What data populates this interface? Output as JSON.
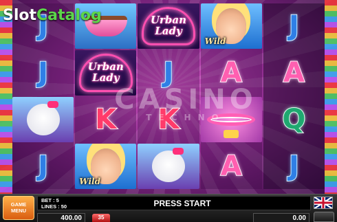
{
  "brand": {
    "slot": "Slot",
    "catalog": "Catalog"
  },
  "watermark": {
    "line1": "CASINO",
    "line2": "TECHNO"
  },
  "reels": [
    [
      {
        "type": "j",
        "glyph": "J"
      },
      {
        "type": "j",
        "glyph": "J"
      },
      {
        "type": "dog"
      },
      {
        "type": "j",
        "glyph": "J"
      }
    ],
    [
      {
        "type": "bowl"
      },
      {
        "type": "logo",
        "line1": "Urban",
        "line2": "Lady"
      },
      {
        "type": "k",
        "glyph": "K"
      },
      {
        "type": "wild",
        "label": "Wild"
      }
    ],
    [
      {
        "type": "logo",
        "line1": "Urban",
        "line2": "Lady"
      },
      {
        "type": "j",
        "glyph": "J"
      },
      {
        "type": "k",
        "glyph": "K"
      },
      {
        "type": "dog"
      }
    ],
    [
      {
        "type": "wild",
        "label": "Wild"
      },
      {
        "type": "a",
        "glyph": "A"
      },
      {
        "type": "collar"
      },
      {
        "type": "a",
        "glyph": "A"
      }
    ],
    [
      {
        "type": "j",
        "glyph": "J"
      },
      {
        "type": "a",
        "glyph": "A"
      },
      {
        "type": "q",
        "glyph": "Q"
      },
      {
        "type": "j",
        "glyph": "J"
      }
    ]
  ],
  "panel": {
    "menu_line1": "GAME",
    "menu_line2": "MENU",
    "bet": "BET : 5",
    "lines": "LINES : 50",
    "status": "PRESS START",
    "credit": "400.00",
    "bet_chip": "35",
    "win": "0.00",
    "flag_icon": "uk-flag-icon"
  }
}
